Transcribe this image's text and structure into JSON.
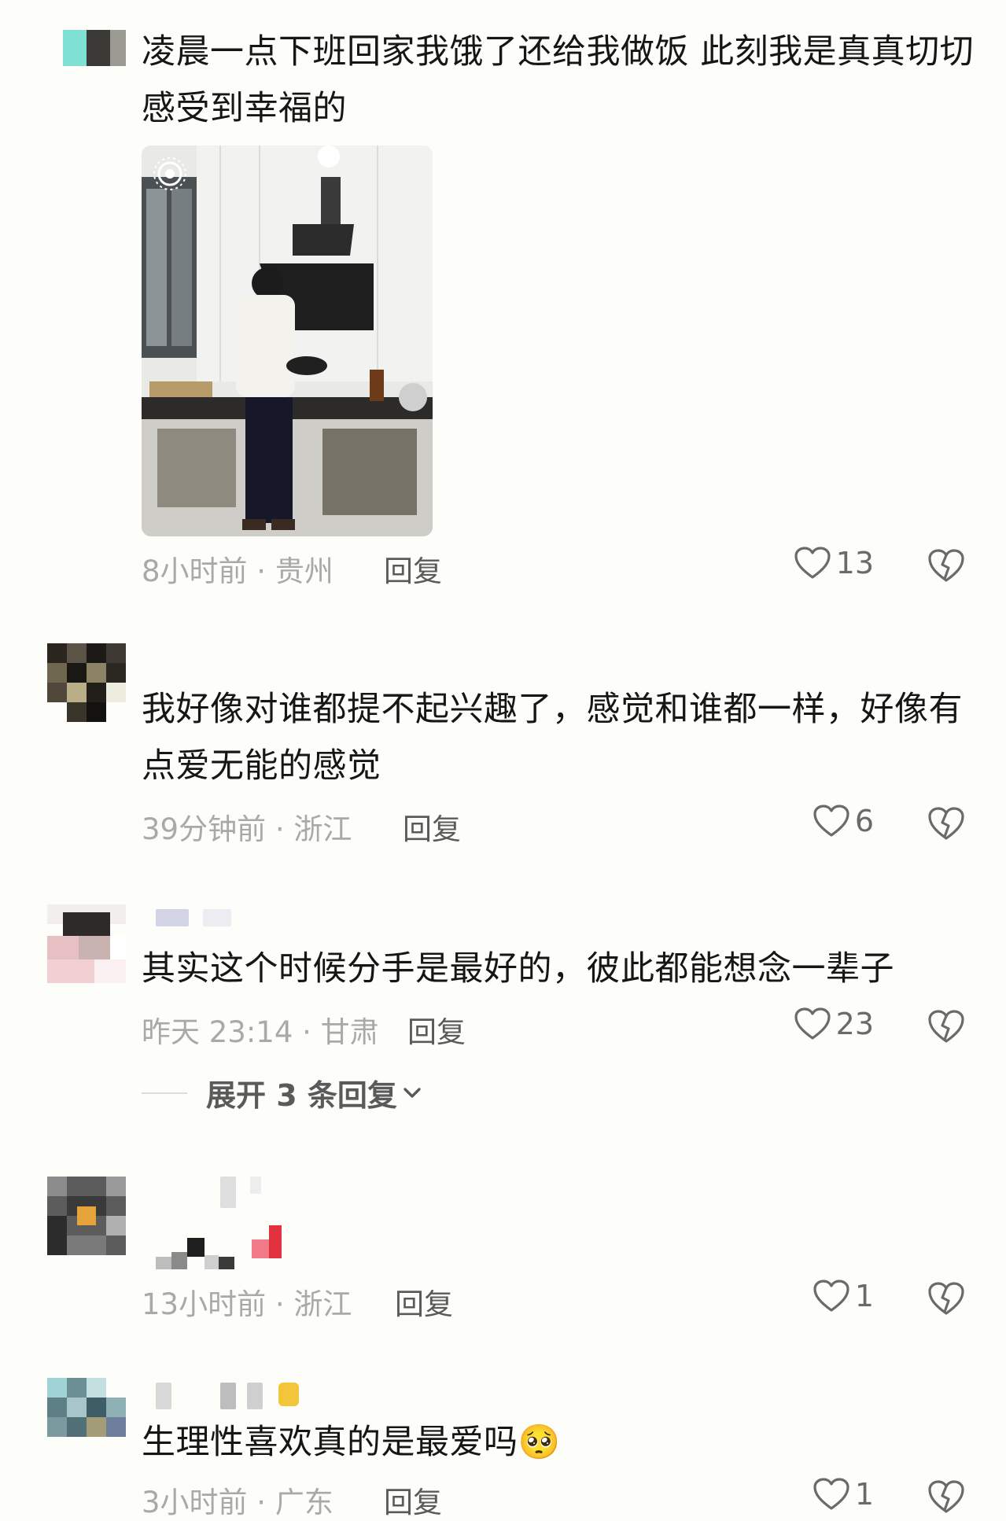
{
  "comments": [
    {
      "text": "凌晨一点下班回家我饿了还给我做饭 此刻我是真真切切感受到幸福的",
      "meta": "8小时前 · 贵州",
      "reply": "回复",
      "likes": "13"
    },
    {
      "text": "我好像对谁都提不起兴趣了，感觉和谁都一样，好像有点爱无能的感觉",
      "meta": "39分钟前 · 浙江",
      "reply": "回复",
      "likes": "6"
    },
    {
      "text": "其实这个时候分手是最好的，彼此都能想念一辈子",
      "meta": "昨天 23:14 · 甘肃",
      "reply": "回复",
      "likes": "23",
      "expand": "展开 3 条回复"
    },
    {
      "text": "",
      "meta": "13小时前 · 浙江",
      "reply": "回复",
      "likes": "1"
    },
    {
      "text": "生理性喜欢真的是最爱吗",
      "emoji": "🥺",
      "meta": "3小时前 · 广东",
      "reply": "回复",
      "likes": "1"
    }
  ],
  "icons": {
    "like": "heart-outline-icon",
    "dislike": "broken-heart-icon",
    "expand": "chevron-down-icon"
  },
  "colors": {
    "background": "#fdfdfa",
    "text": "#161616",
    "meta": "#a9a9a9"
  }
}
